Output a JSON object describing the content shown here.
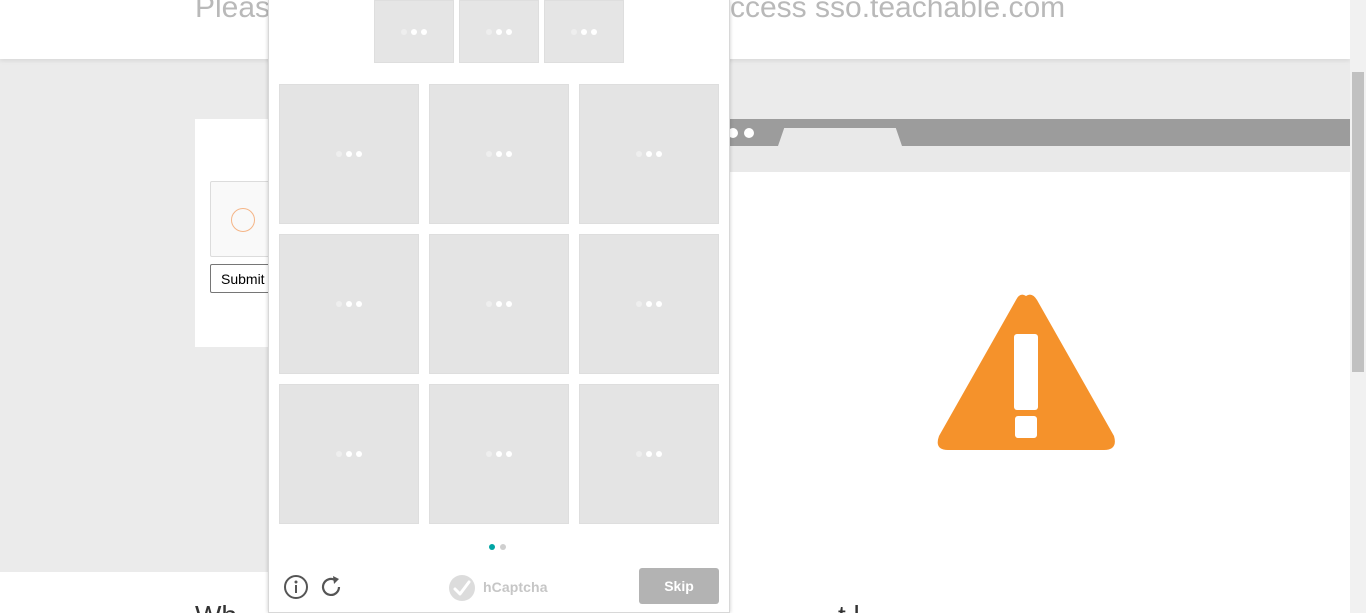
{
  "page": {
    "headline_left": "Please",
    "headline_right": "ccess sso.teachable.com",
    "submit_label": "Submit",
    "bottom_text_left": "Wh",
    "bottom_text_right": "t l ... ...  ... ... ..."
  },
  "browser_illustration": {
    "warning_color": "#F5922B",
    "bar_color": "#9C9C9C"
  },
  "challenge": {
    "example_count": 3,
    "tile_count": 9,
    "pager": {
      "pages": 2,
      "active_page": 1
    },
    "brand_name": "hCaptcha",
    "skip_label": "Skip",
    "accent_color": "#00A5A4",
    "icons": {
      "info": "info-icon",
      "refresh": "refresh-icon",
      "brand": "hcaptcha-logo-icon",
      "loading": "loading-dots-icon"
    }
  }
}
